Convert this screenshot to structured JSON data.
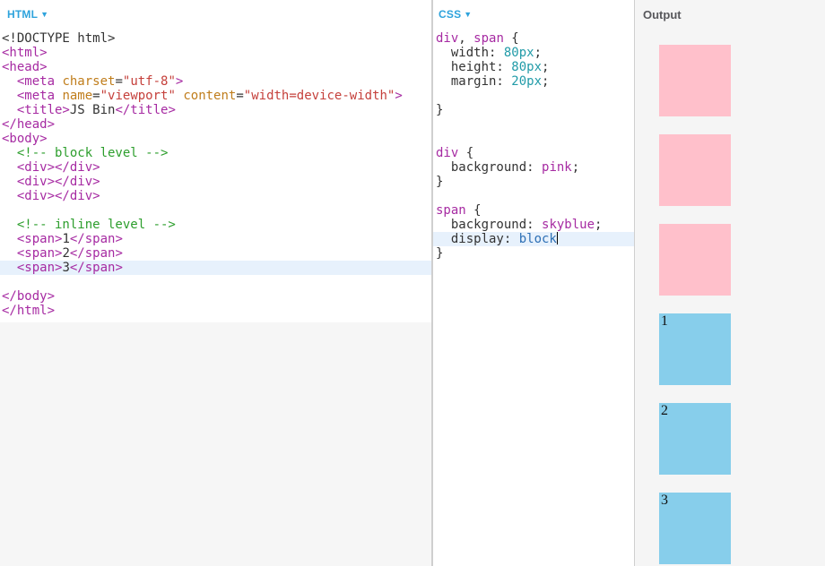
{
  "colors": {
    "label_blue": "#2ea3dc",
    "output_label": "#58585c",
    "tag": "#a62aa2",
    "attr": "#c07d1b",
    "str": "#c5403b",
    "com": "#2c9e2c",
    "num": "#219ba8",
    "kw": "#a62aa2",
    "blu": "#2d6fb5",
    "pln": "#333333",
    "active_line": "#e7f1fc",
    "pink": "#ffc0cb",
    "skyblue": "#87ceeb",
    "editor_bg": "#ffffff",
    "panel_gray": "#f6f6f6",
    "output_bg": "#f5f5f5",
    "divider": "#cfcfcf"
  },
  "panels": {
    "html": {
      "label": "HTML",
      "caret": "▼",
      "lines": [
        {
          "toks": [
            [
              "pln",
              "<!DOCTYPE html>"
            ]
          ]
        },
        {
          "toks": [
            [
              "tag",
              "<html>"
            ]
          ]
        },
        {
          "toks": [
            [
              "tag",
              "<head>"
            ]
          ]
        },
        {
          "toks": [
            [
              "pln",
              "  "
            ],
            [
              "tag",
              "<meta"
            ],
            [
              "attr",
              " charset"
            ],
            [
              "pln",
              "="
            ],
            [
              "str",
              "\"utf-8\""
            ],
            [
              "tag",
              ">"
            ]
          ]
        },
        {
          "toks": [
            [
              "pln",
              "  "
            ],
            [
              "tag",
              "<meta"
            ],
            [
              "attr",
              " name"
            ],
            [
              "pln",
              "="
            ],
            [
              "str",
              "\"viewport\""
            ],
            [
              "attr",
              " content"
            ],
            [
              "pln",
              "="
            ],
            [
              "str",
              "\"width=device-width\""
            ],
            [
              "tag",
              ">"
            ]
          ]
        },
        {
          "toks": [
            [
              "pln",
              "  "
            ],
            [
              "tag",
              "<title>"
            ],
            [
              "pln",
              "JS Bin"
            ],
            [
              "tag",
              "</title>"
            ]
          ]
        },
        {
          "toks": [
            [
              "tag",
              "</head>"
            ]
          ]
        },
        {
          "toks": [
            [
              "tag",
              "<body>"
            ]
          ]
        },
        {
          "toks": [
            [
              "pln",
              "  "
            ],
            [
              "com",
              "<!-- block level -->"
            ]
          ]
        },
        {
          "toks": [
            [
              "pln",
              "  "
            ],
            [
              "tag",
              "<div></div>"
            ]
          ]
        },
        {
          "toks": [
            [
              "pln",
              "  "
            ],
            [
              "tag",
              "<div></div>"
            ]
          ]
        },
        {
          "toks": [
            [
              "pln",
              "  "
            ],
            [
              "tag",
              "<div></div>"
            ]
          ]
        },
        {
          "toks": []
        },
        {
          "toks": [
            [
              "pln",
              "  "
            ],
            [
              "com",
              "<!-- inline level -->"
            ]
          ]
        },
        {
          "toks": [
            [
              "pln",
              "  "
            ],
            [
              "tag",
              "<span>"
            ],
            [
              "pln",
              "1"
            ],
            [
              "tag",
              "</span>"
            ]
          ]
        },
        {
          "toks": [
            [
              "pln",
              "  "
            ],
            [
              "tag",
              "<span>"
            ],
            [
              "pln",
              "2"
            ],
            [
              "tag",
              "</span>"
            ]
          ]
        },
        {
          "hl": true,
          "toks": [
            [
              "pln",
              "  "
            ],
            [
              "tag",
              "<span>"
            ],
            [
              "pln",
              "3"
            ],
            [
              "tag",
              "</span>"
            ]
          ]
        },
        {
          "toks": []
        },
        {
          "toks": [
            [
              "tag",
              "</body>"
            ]
          ]
        },
        {
          "toks": [
            [
              "tag",
              "</html>"
            ]
          ]
        }
      ]
    },
    "css": {
      "label": "CSS",
      "caret": "▼",
      "lines": [
        {
          "toks": [
            [
              "tag",
              "div"
            ],
            [
              "pln",
              ", "
            ],
            [
              "tag",
              "span"
            ],
            [
              "pln",
              " {"
            ]
          ]
        },
        {
          "toks": [
            [
              "pln",
              "  width: "
            ],
            [
              "num",
              "80px"
            ],
            [
              "pln",
              ";"
            ]
          ]
        },
        {
          "toks": [
            [
              "pln",
              "  height: "
            ],
            [
              "num",
              "80px"
            ],
            [
              "pln",
              ";"
            ]
          ]
        },
        {
          "toks": [
            [
              "pln",
              "  margin: "
            ],
            [
              "num",
              "20px"
            ],
            [
              "pln",
              ";"
            ]
          ]
        },
        {
          "toks": []
        },
        {
          "toks": [
            [
              "pln",
              "}"
            ]
          ]
        },
        {
          "toks": []
        },
        {
          "toks": []
        },
        {
          "toks": [
            [
              "tag",
              "div"
            ],
            [
              "pln",
              " {"
            ]
          ]
        },
        {
          "toks": [
            [
              "pln",
              "  background: "
            ],
            [
              "kw",
              "pink"
            ],
            [
              "pln",
              ";"
            ]
          ]
        },
        {
          "toks": [
            [
              "pln",
              "}"
            ]
          ]
        },
        {
          "toks": []
        },
        {
          "toks": [
            [
              "tag",
              "span"
            ],
            [
              "pln",
              " {"
            ]
          ]
        },
        {
          "toks": [
            [
              "pln",
              "  background: "
            ],
            [
              "kw",
              "skyblue"
            ],
            [
              "pln",
              ";"
            ]
          ]
        },
        {
          "hl": true,
          "cur": true,
          "toks": [
            [
              "pln",
              "  display: "
            ],
            [
              "blu",
              "block"
            ]
          ]
        },
        {
          "toks": [
            [
              "pln",
              "}"
            ]
          ]
        }
      ]
    },
    "output": {
      "label": "Output",
      "boxes": [
        {
          "fill": "pink",
          "label": ""
        },
        {
          "fill": "pink",
          "label": ""
        },
        {
          "fill": "pink",
          "label": ""
        },
        {
          "fill": "skyblue",
          "label": "1"
        },
        {
          "fill": "skyblue",
          "label": "2"
        },
        {
          "fill": "skyblue",
          "label": "3"
        }
      ]
    }
  }
}
